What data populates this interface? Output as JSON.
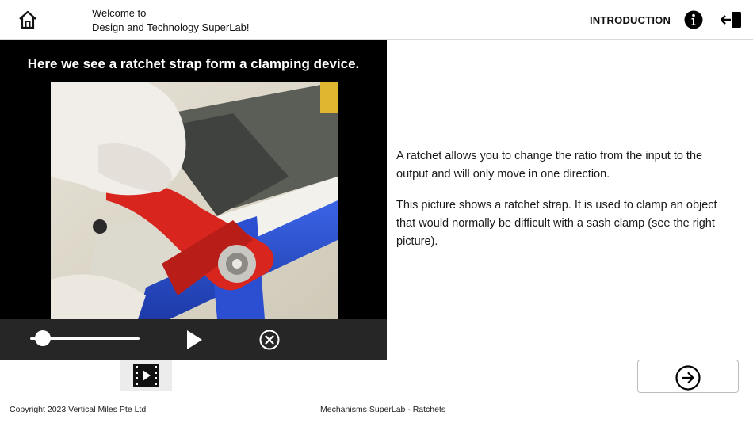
{
  "header": {
    "welcome_line1": "Welcome to",
    "welcome_line2": "Design and Technology SuperLab!",
    "intro_label": "INTRODUCTION",
    "home_icon": "home-icon",
    "info_icon": "info-icon",
    "exit_icon": "exit-icon"
  },
  "video": {
    "caption": "Here we see a ratchet strap form a clamping device.",
    "progress": 0.05,
    "controls": {
      "play_icon": "play-icon",
      "close_icon": "close-circle-icon"
    }
  },
  "media_button": {
    "icon": "film-video-icon"
  },
  "content": {
    "paragraph1": "A ratchet allows you to change the ratio from the input to the output and will only move in one direction.",
    "paragraph2": "This picture shows a ratchet strap. It is used to clamp an object that would normally be difficult with a sash clamp (see the right picture)."
  },
  "navigation": {
    "next_icon": "arrow-right-circle-icon"
  },
  "footer": {
    "copyright": "Copyright 2023 Vertical Miles Pte Ltd",
    "lab_title": "Mechanisms SuperLab - Ratchets"
  },
  "colors": {
    "video_bg": "#000000",
    "controls_bg": "#262626",
    "strap_blue": "#2b4fd0",
    "ratchet_red": "#d8261f"
  }
}
